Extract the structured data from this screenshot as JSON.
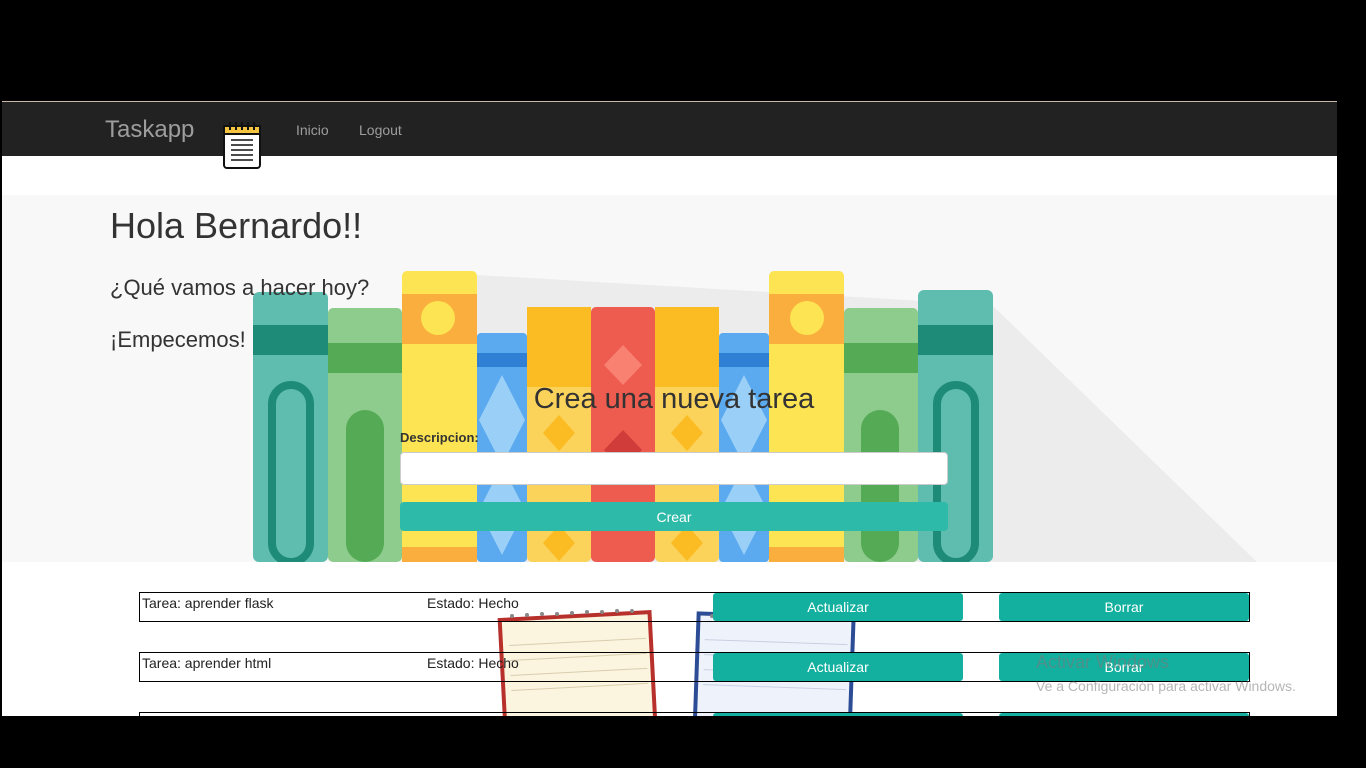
{
  "navbar": {
    "brand": "Taskapp",
    "links": [
      "Inicio",
      "Logout"
    ]
  },
  "jumbotron": {
    "greeting": "Hola Bernardo!!",
    "question": "¿Qué vamos a hacer hoy?",
    "start": "¡Empecemos!"
  },
  "form": {
    "title": "Crea una nueva tarea",
    "label": "Descripcion:",
    "input_value": "",
    "submit": "Crear"
  },
  "tasks": [
    {
      "name": "Tarea: aprender flask",
      "status": "Estado: Hecho",
      "update": "Actualizar",
      "delete": "Borrar"
    },
    {
      "name": "Tarea: aprender html",
      "status": "Estado: Hecho",
      "update": "Actualizar",
      "delete": "Borrar"
    },
    {
      "name": "",
      "status": "",
      "update": "",
      "delete": ""
    }
  ],
  "watermark": {
    "title": "Activar Windows",
    "subtitle": "Ve a Configuración para activar Windows."
  },
  "colors": {
    "navbar": "#222222",
    "accent": "#14b09f",
    "jumbotron": "#f8f8f8"
  }
}
